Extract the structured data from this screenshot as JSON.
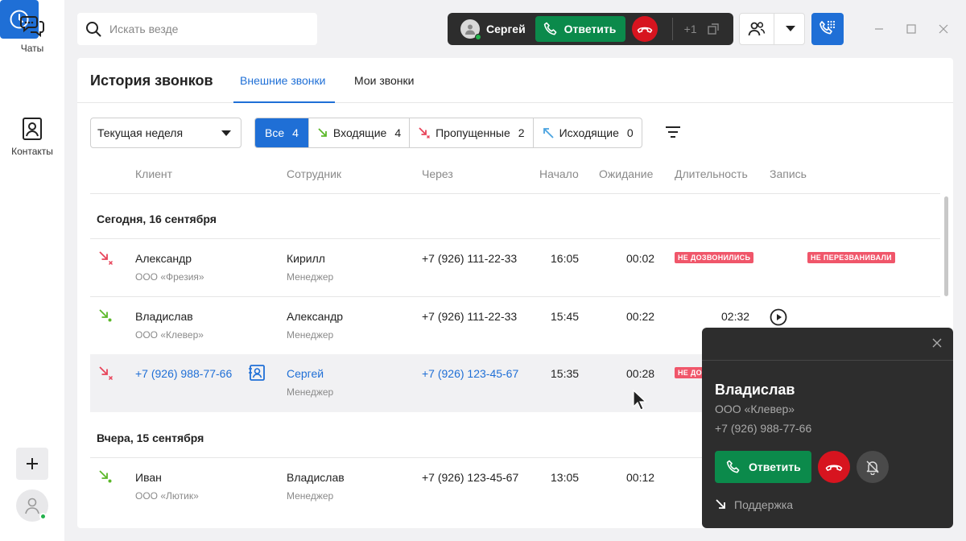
{
  "nav": {
    "chats_label": "Чаты",
    "contacts_label": "Контакты"
  },
  "search": {
    "placeholder": "Искать везде"
  },
  "callbar": {
    "caller": "Сергей",
    "answer_label": "Ответить",
    "more_count": "+1"
  },
  "page": {
    "title": "История звонков",
    "tabs": [
      "Внешние звонки",
      "Мои звонки"
    ]
  },
  "period": {
    "selected": "Текущая неделя"
  },
  "filters": [
    {
      "label": "Все",
      "count": "4"
    },
    {
      "label": "Входящие",
      "count": "4"
    },
    {
      "label": "Пропущенные",
      "count": "2"
    },
    {
      "label": "Исходящие",
      "count": "0"
    }
  ],
  "columns": [
    "Клиент",
    "Сотрудник",
    "Через",
    "Начало",
    "Ожидание",
    "Длительность",
    "Запись"
  ],
  "groups": [
    {
      "title": "Сегодня, 16 сентября"
    },
    {
      "title": "Вчера, 15 сентября"
    }
  ],
  "rows": [
    {
      "type": "missed",
      "client": "Александр",
      "client_org": "ООО «Фрезия»",
      "employee": "Кирилл",
      "employee_role": "Менеджер",
      "via": "+7 (926) 111-22-33",
      "start": "16:05",
      "wait": "00:02",
      "duration_badge": "НЕ ДОЗВОНИЛИСЬ",
      "record_badge": "НЕ ПЕРЕЗВАНИВАЛИ"
    },
    {
      "type": "incoming",
      "client": "Владислав",
      "client_org": "ООО «Клевер»",
      "employee": "Александр",
      "employee_role": "Менеджер",
      "via": "+7 (926) 111-22-33",
      "start": "15:45",
      "wait": "00:22",
      "duration": "02:32"
    },
    {
      "type": "missed",
      "client": "+7 (926) 988-77-66",
      "employee": "Сергей",
      "employee_role": "Менеджер",
      "via": "+7 (926) 123-45-67",
      "start": "15:35",
      "wait": "00:28",
      "duration_badge": "НЕ ДО"
    },
    {
      "type": "incoming",
      "client": "Иван",
      "client_org": "ООО «Лютик»",
      "employee": "Владислав",
      "employee_role": "Менеджер",
      "via": "+7 (926) 123-45-67",
      "start": "13:05",
      "wait": "00:12"
    }
  ],
  "popup": {
    "name": "Владислав",
    "org": "ООО «Клевер»",
    "phone": "+7 (926) 988-77-66",
    "answer_label": "Ответить",
    "line": "Поддержка"
  },
  "colors": {
    "accent": "#1f6fd6",
    "answer_green": "#0b8a4b",
    "hangup_red": "#d7141f",
    "badge_red": "#f0566a",
    "incoming_green": "#5cb82a",
    "missed_red": "#e8445a",
    "outgoing_blue": "#4aa3e0"
  }
}
